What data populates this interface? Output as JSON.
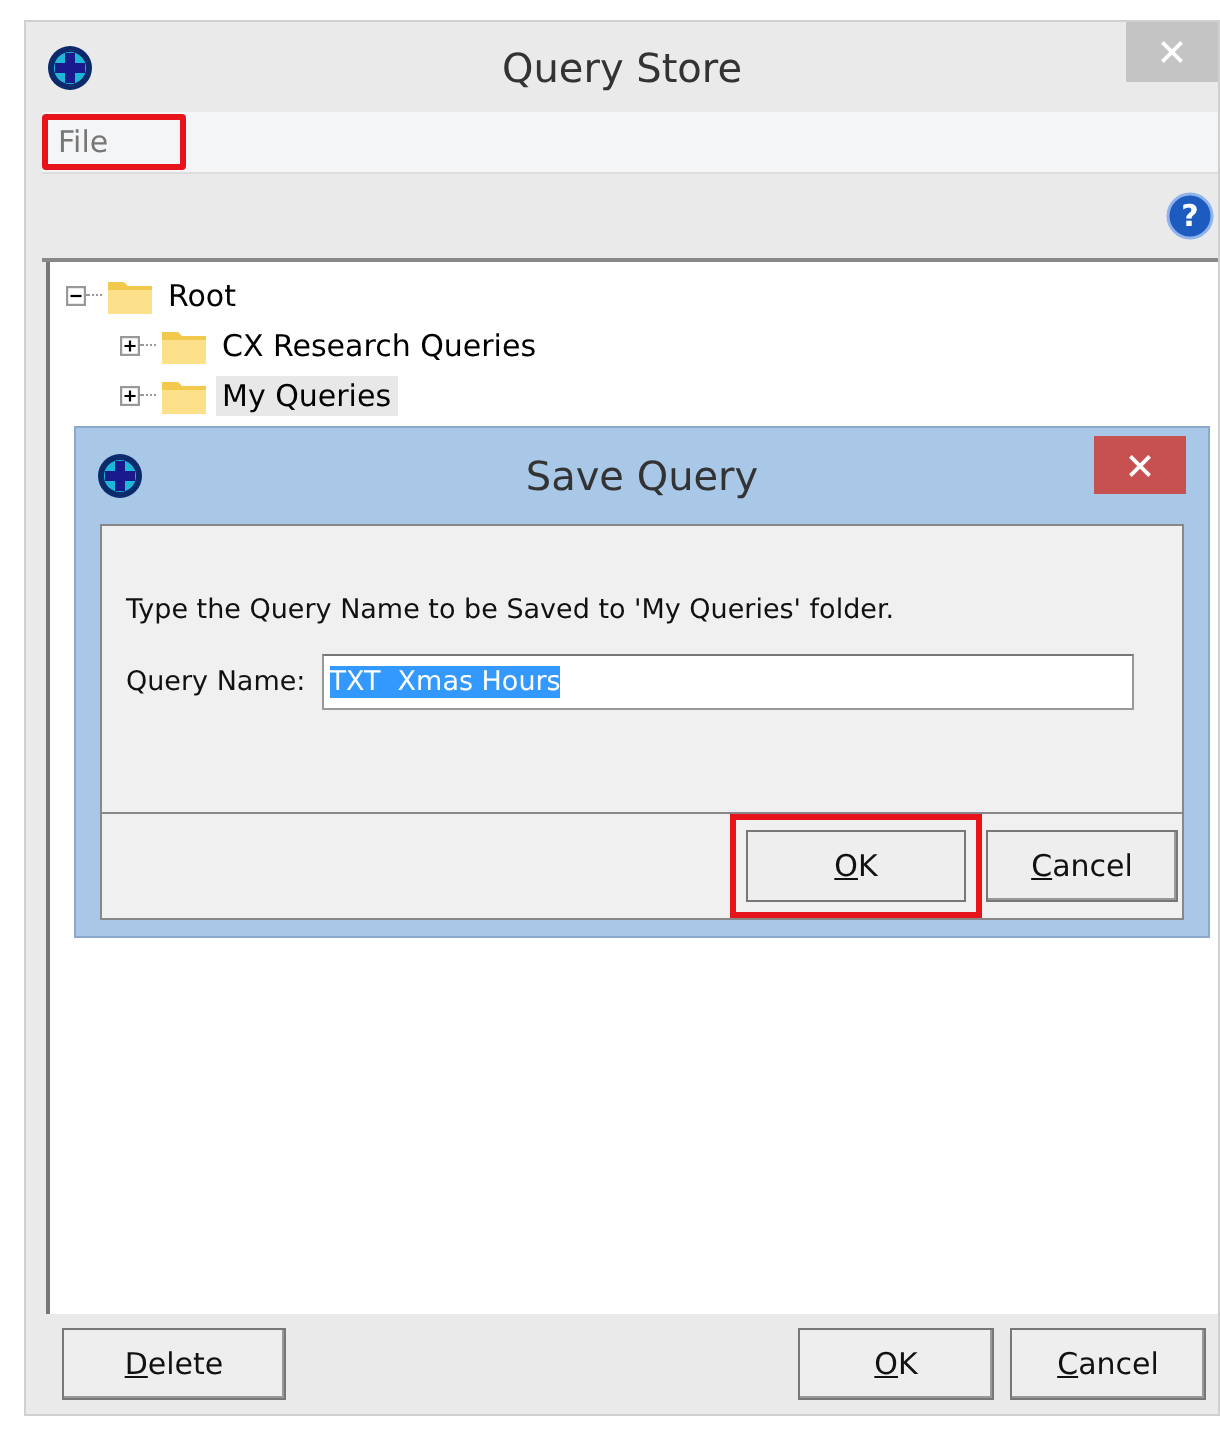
{
  "window": {
    "title": "Query Store"
  },
  "toolbar": {
    "help": "?"
  },
  "menu": [
    {
      "label": "File",
      "highlighted": true
    }
  ],
  "tree": [
    {
      "label": "Root",
      "expanded": true,
      "selected": false,
      "children": [
        {
          "label": "CX Research Queries",
          "expanded": false,
          "selected": false
        },
        {
          "label": "My Queries",
          "expanded": false,
          "selected": true
        }
      ]
    }
  ],
  "buttons": [
    {
      "label": "Delete",
      "kind": "left",
      "highlighted": false
    },
    {
      "label": "OK",
      "kind": "right",
      "highlighted": false
    },
    {
      "label": "Cancel",
      "kind": "right",
      "highlighted": false
    }
  ],
  "dialog": {
    "title": "Save Query",
    "message": "Type the Query Name to be Saved to 'My Queries' folder.",
    "field_label": "Query Name:",
    "value": "TXT  Xmas Hours",
    "buttons": [
      {
        "label": "OK",
        "highlighted": true
      },
      {
        "label": "Cancel",
        "highlighted": false
      }
    ]
  }
}
